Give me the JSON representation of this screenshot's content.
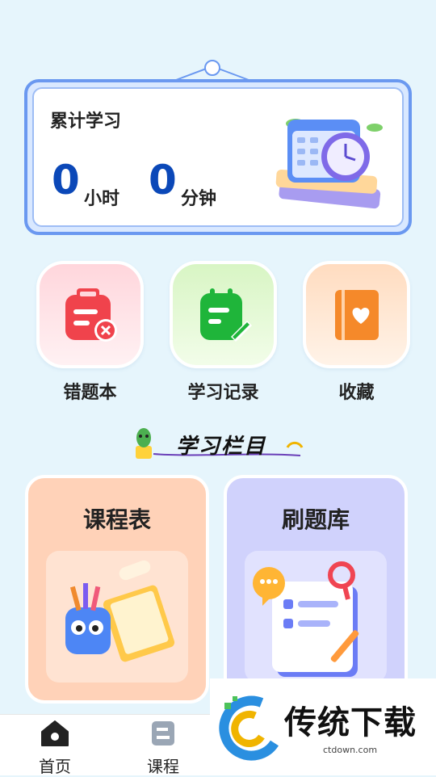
{
  "stats": {
    "title": "累计学习",
    "hours_value": "0",
    "hours_unit": "小时",
    "minutes_value": "0",
    "minutes_unit": "分钟"
  },
  "quick_actions": [
    {
      "label": "错题本",
      "icon": "clipboard-x-icon"
    },
    {
      "label": "学习记录",
      "icon": "notepad-pen-icon"
    },
    {
      "label": "收藏",
      "icon": "heart-book-icon"
    }
  ],
  "section": {
    "title": "学习栏目"
  },
  "cards": [
    {
      "title": "课程表"
    },
    {
      "title": "刷题库"
    }
  ],
  "tabbar": [
    {
      "label": "首页",
      "icon": "home-icon"
    },
    {
      "label": "课程",
      "icon": "course-icon"
    }
  ],
  "watermark": {
    "text": "传统下载",
    "url": "ctdown.com"
  },
  "colors": {
    "accent": "#0b48b8",
    "card_border": "#6a98f0",
    "background": "#e6f5fc"
  }
}
